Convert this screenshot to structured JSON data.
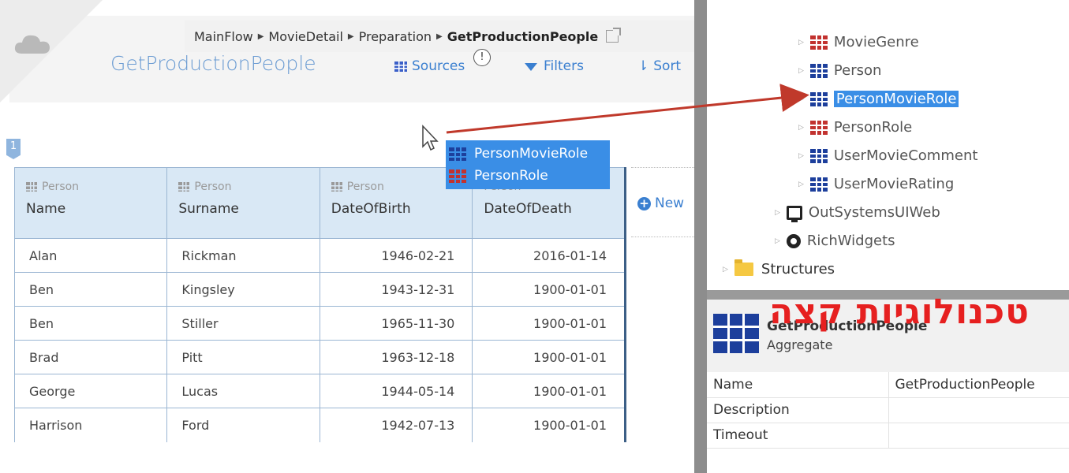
{
  "breadcrumb": {
    "items": [
      "MainFlow",
      "MovieDetail",
      "Preparation"
    ],
    "current": "GetProductionPeople",
    "separator": "▶"
  },
  "aggregate": {
    "title": "GetProductionPeople",
    "sources_label": "Sources",
    "filters_label": "Filters",
    "sort_label": "Sort",
    "info_badge": "!",
    "marker": "1",
    "new_label": "New"
  },
  "table": {
    "columns": [
      {
        "entity": "Person",
        "name": "Name"
      },
      {
        "entity": "Person",
        "name": "Surname"
      },
      {
        "entity": "Person",
        "name": "DateOfBirth"
      },
      {
        "entity": "Person",
        "name": "DateOfDeath"
      }
    ],
    "rows": [
      [
        "Alan",
        "Rickman",
        "1946-02-21",
        "2016-01-14"
      ],
      [
        "Ben",
        "Kingsley",
        "1943-12-31",
        "1900-01-01"
      ],
      [
        "Ben",
        "Stiller",
        "1965-11-30",
        "1900-01-01"
      ],
      [
        "Brad",
        "Pitt",
        "1963-12-18",
        "1900-01-01"
      ],
      [
        "George",
        "Lucas",
        "1944-05-14",
        "1900-01-01"
      ],
      [
        "Harrison",
        "Ford",
        "1942-07-13",
        "1900-01-01"
      ]
    ]
  },
  "drag_tooltip": {
    "items": [
      {
        "label": "PersonMovieRole",
        "icon": "entity-blue-icon"
      },
      {
        "label": "PersonRole",
        "icon": "entity-red-icon"
      }
    ]
  },
  "tree": {
    "entities": [
      {
        "label": "MovieGenre",
        "icon": "entity-red-icon"
      },
      {
        "label": "Person",
        "icon": "entity-blue-icon"
      },
      {
        "label": "PersonMovieRole",
        "icon": "entity-blue-icon",
        "selected": true
      },
      {
        "label": "PersonRole",
        "icon": "entity-red-icon"
      },
      {
        "label": "UserMovieComment",
        "icon": "entity-blue-icon"
      },
      {
        "label": "UserMovieRating",
        "icon": "entity-blue-icon"
      }
    ],
    "modules": [
      {
        "label": "OutSystemsUIWeb",
        "icon": "monitor-icon"
      },
      {
        "label": "RichWidgets",
        "icon": "ring-icon"
      }
    ],
    "folder": {
      "label": "Structures",
      "icon": "folder-icon"
    }
  },
  "properties": {
    "name": "GetProductionPeople",
    "type": "Aggregate",
    "rows": [
      {
        "label": "Name",
        "value": "GetProductionPeople"
      },
      {
        "label": "Description",
        "value": ""
      },
      {
        "label": "Timeout",
        "value": ""
      }
    ]
  },
  "watermark": "טכנולוגיות קצה",
  "colors": {
    "accent_blue": "#3a8ee6",
    "link_blue": "#3a7fd0",
    "title_blue": "#6a9bd2",
    "entity_red": "#c2322f",
    "entity_blue": "#1d3f9c",
    "header_cell": "#d9e8f5",
    "arrow_red": "#c0392b",
    "watermark_red": "#e62020"
  }
}
